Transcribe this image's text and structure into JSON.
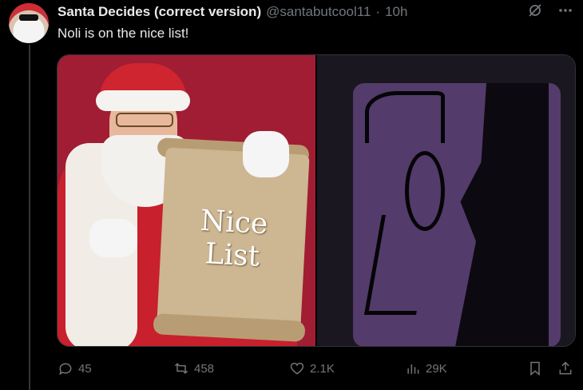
{
  "tweet": {
    "display_name": "Santa Decides (correct version)",
    "handle": "@santabutcool11",
    "separator": "·",
    "time": "10h",
    "text": "Noli is on the nice list!"
  },
  "media": {
    "scroll_text_line1": "Nice",
    "scroll_text_line2": "List"
  },
  "actions": {
    "replies": "45",
    "reposts": "458",
    "likes": "2.1K",
    "views": "29K"
  },
  "icons": [
    "grok-icon",
    "more-icon",
    "reply-icon",
    "repost-icon",
    "like-icon",
    "views-icon",
    "bookmark-icon",
    "share-icon"
  ]
}
